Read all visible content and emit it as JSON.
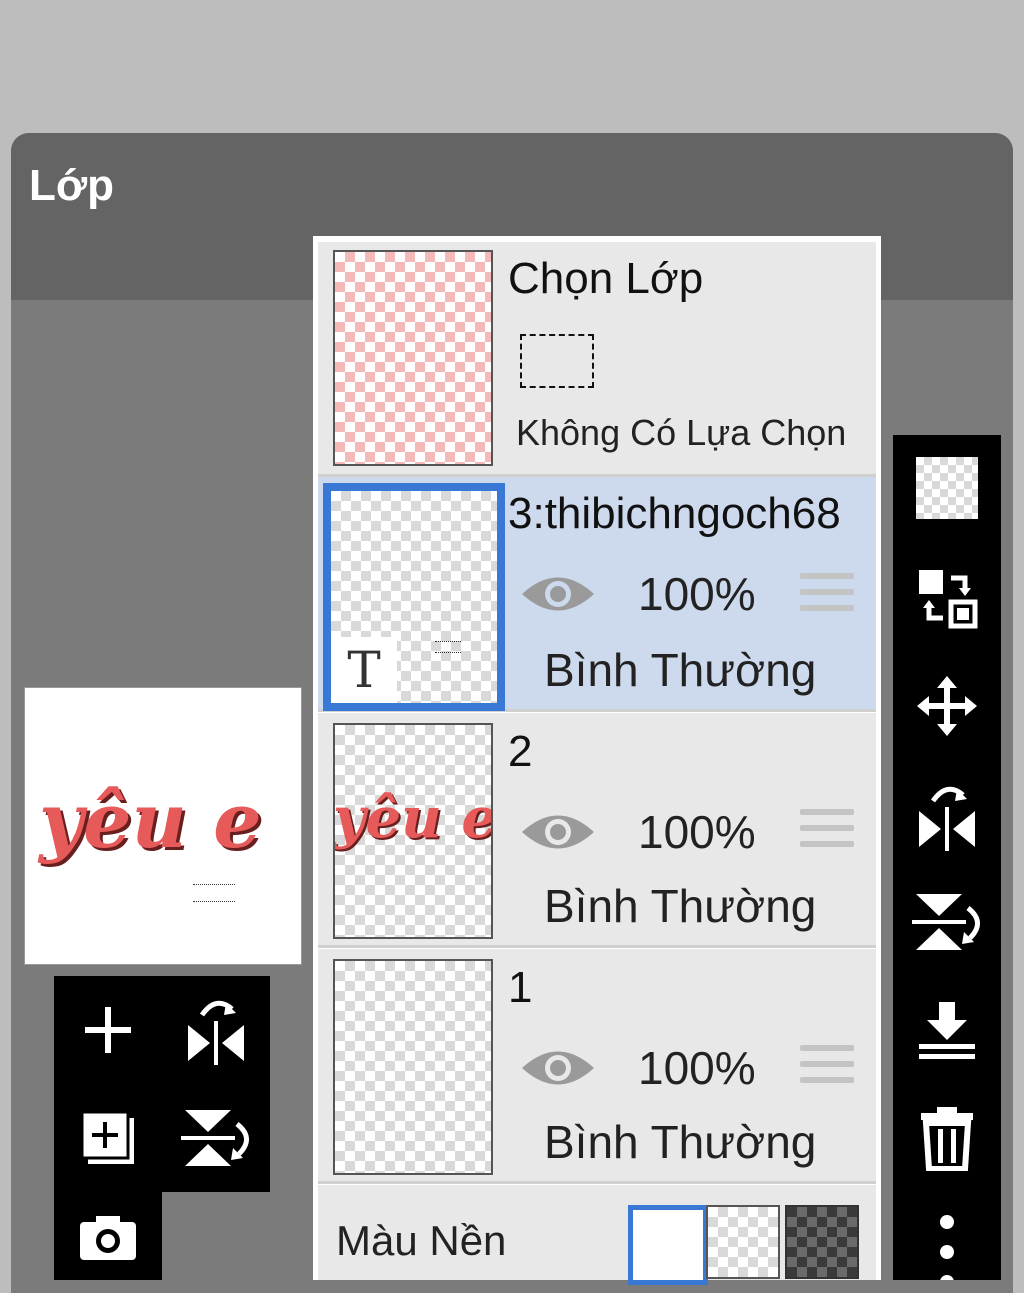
{
  "panel": {
    "title": "Lớp"
  },
  "selection": {
    "title": "Chọn Lớp",
    "status": "Không Có Lựa Chọn"
  },
  "layers": [
    {
      "name": "3:thibichngoch68",
      "opacity": "100%",
      "blend": "Bình Thường",
      "selected": true,
      "thumb_badge": "T"
    },
    {
      "name": "2",
      "opacity": "100%",
      "blend": "Bình Thường",
      "selected": false,
      "thumb_text": "yêu e"
    },
    {
      "name": "1",
      "opacity": "100%",
      "blend": "Bình Thường",
      "selected": false
    }
  ],
  "background": {
    "label": "Màu Nền",
    "options": [
      "white",
      "transparent",
      "dark-checker"
    ],
    "selected": "white"
  },
  "preview": {
    "text": "yêu e"
  },
  "right_toolbar": [
    "transparency-icon",
    "swap-layers-icon",
    "move-icon",
    "flip-horizontal-icon",
    "flip-vertical-icon",
    "merge-down-icon",
    "delete-icon",
    "more-icon"
  ],
  "left_toolbar": [
    "add-layer-icon",
    "flip-horizontal-icon",
    "duplicate-layer-icon",
    "flip-vertical-icon",
    "camera-icon"
  ],
  "colors": {
    "accent": "#3a78d6",
    "selected_row": "#cdd9ec",
    "text_red": "#e53935"
  }
}
